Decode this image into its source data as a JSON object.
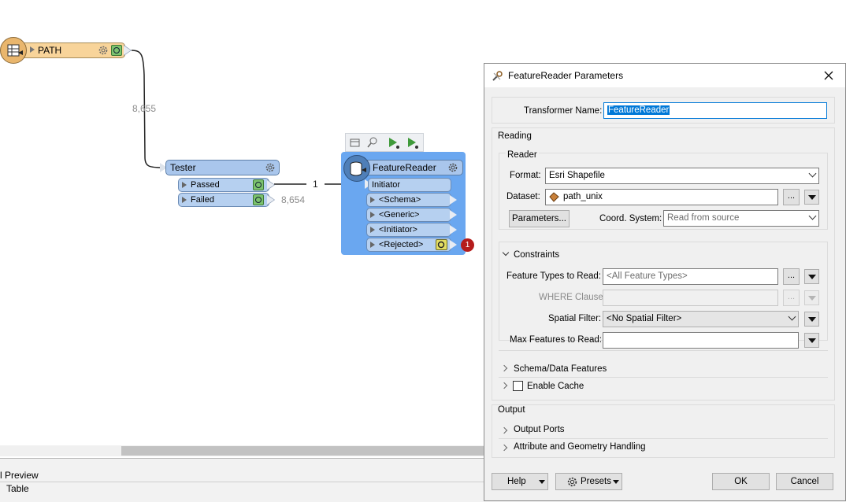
{
  "canvas": {
    "path_node": {
      "label": "PATH"
    },
    "link_path_tester": {
      "count": "8,655"
    },
    "tester": {
      "label": "Tester",
      "ports": [
        {
          "label": "Passed",
          "count": "1"
        },
        {
          "label": "Failed",
          "count": "8,654"
        }
      ]
    },
    "feature_reader": {
      "label": "FeatureReader",
      "input_port": "Initiator",
      "output_ports": [
        "<Schema>",
        "<Generic>",
        "<Initiator>",
        "<Rejected>"
      ],
      "rejected_badge": "1"
    }
  },
  "bottom_panel": {
    "title": "l Preview",
    "tab": "Table"
  },
  "dialog": {
    "title": "FeatureReader Parameters",
    "transformer_name_label": "Transformer Name:",
    "transformer_name_value": "FeatureReader",
    "reading": {
      "title": "Reading",
      "reader_title": "Reader",
      "format_label": "Format:",
      "format_value": "Esri Shapefile",
      "dataset_label": "Dataset:",
      "dataset_value": "path_unix",
      "parameters_button": "Parameters...",
      "coord_label": "Coord. System:",
      "coord_placeholder": "Read from source",
      "ellipsis": "..."
    },
    "constraints": {
      "title": "Constraints",
      "feature_types_label": "Feature Types to Read:",
      "feature_types_placeholder": "<All Feature Types>",
      "where_label": "WHERE Clause:",
      "spatial_label": "Spatial Filter:",
      "spatial_value": "<No Spatial Filter>",
      "max_label": "Max Features to Read:"
    },
    "schema_label": "Schema/Data Features",
    "enable_cache_label": "Enable Cache",
    "output": {
      "title": "Output",
      "output_ports_label": "Output Ports",
      "attr_geom_label": "Attribute and Geometry Handling"
    },
    "footer": {
      "help": "Help",
      "presets": "Presets",
      "ok": "OK",
      "cancel": "Cancel"
    }
  }
}
